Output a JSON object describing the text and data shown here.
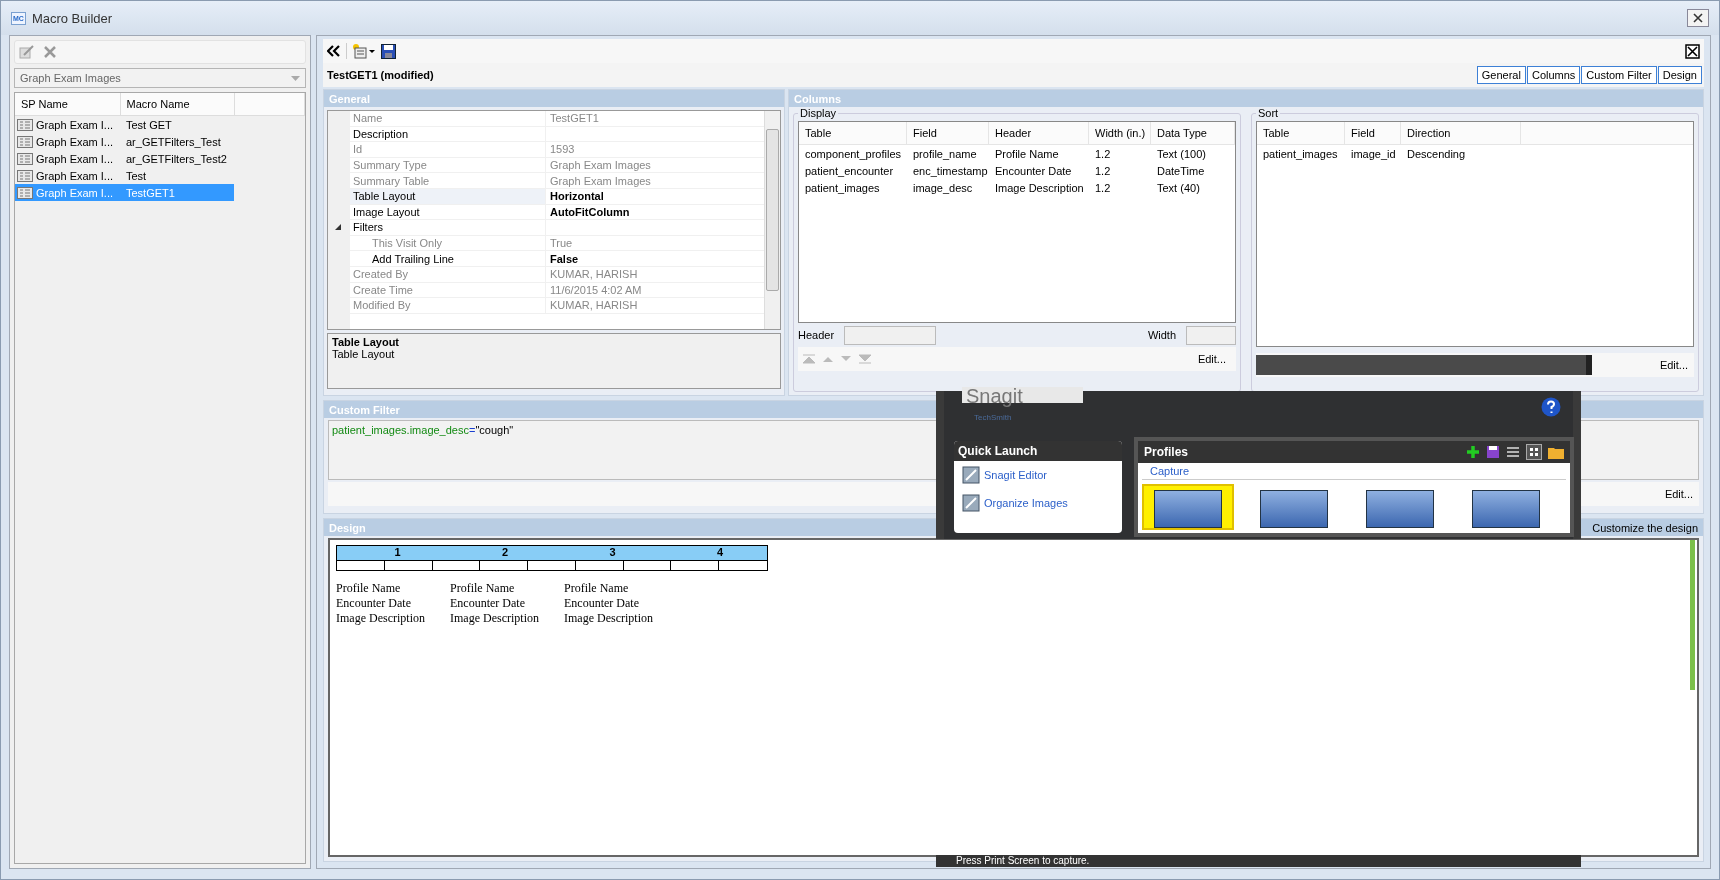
{
  "window": {
    "title": "Macro Builder",
    "icon_text": "MC"
  },
  "sidebar": {
    "dropdown": {
      "value": "Graph Exam Images"
    },
    "columns": [
      "SP Name",
      "Macro Name"
    ],
    "rows": [
      {
        "sp_name": "Graph Exam I...",
        "macro_name": "Test GET",
        "selected": false
      },
      {
        "sp_name": "Graph Exam I...",
        "macro_name": "ar_GETFilters_Test",
        "selected": false
      },
      {
        "sp_name": "Graph Exam I...",
        "macro_name": "ar_GETFilters_Test2",
        "selected": false
      },
      {
        "sp_name": "Graph Exam I...",
        "macro_name": "Test",
        "selected": false
      },
      {
        "sp_name": "Graph Exam I...",
        "macro_name": "TestGET1",
        "selected": true
      }
    ]
  },
  "editor": {
    "title": "TestGET1 (modified)",
    "tabs": [
      {
        "label": "General",
        "selected": false
      },
      {
        "label": "Columns",
        "selected": false
      },
      {
        "label": "Custom Filter",
        "selected": false
      },
      {
        "label": "Design",
        "selected": false
      }
    ]
  },
  "general": {
    "heading": "General",
    "properties": [
      {
        "name": "Name",
        "value": "TestGET1",
        "readonly": true,
        "changed": false,
        "selected": false
      },
      {
        "name": "Description",
        "readonly": false,
        "selected": false
      },
      {
        "name": "Id",
        "value": "1593",
        "readonly": true,
        "changed": false,
        "selected": false
      },
      {
        "name": "Summary Type",
        "value": "Graph Exam Images",
        "readonly": true,
        "changed": false,
        "selected": false
      },
      {
        "name": "Summary Table",
        "value": "Graph Exam Images",
        "readonly": true,
        "changed": false,
        "selected": false
      },
      {
        "name": "Table Layout",
        "value": "Horizontal",
        "readonly": false,
        "changed": true,
        "selected": true
      },
      {
        "name": "Image Layout",
        "value": "AutoFitColumn",
        "readonly": false,
        "changed": true,
        "selected": false
      },
      {
        "name": "Filters",
        "expanded": true,
        "children": [
          {
            "name": "This Visit Only",
            "value": "True",
            "readonly": true,
            "changed": false,
            "selected": false
          },
          {
            "name": "Add Trailing Line",
            "value": "False",
            "readonly": false,
            "changed": true,
            "selected": false
          }
        ]
      },
      {
        "name": "Created By",
        "value": "KUMAR, HARISH",
        "readonly": true,
        "changed": false,
        "selected": false
      },
      {
        "name": "Create Time",
        "value": "11/6/2015 4:02 AM",
        "readonly": true,
        "changed": false,
        "selected": false
      },
      {
        "name": "Modified By",
        "value": "KUMAR, HARISH",
        "readonly": true,
        "changed": false,
        "selected": false
      }
    ],
    "description": {
      "title": "Table Layout",
      "text": "Table Layout"
    }
  },
  "columns": {
    "heading": "Columns",
    "display": {
      "label": "Display",
      "columns": [
        "Table",
        "Field",
        "Header",
        "Width (in.)",
        "Data Type"
      ],
      "rows": [
        [
          "component_profiles",
          "profile_name",
          "Profile Name",
          "1.2",
          "Text (100)"
        ],
        [
          "patient_encounter",
          "enc_timestamp",
          "Encounter Date",
          "1.2",
          "DateTime"
        ],
        [
          "patient_images",
          "image_desc",
          "Image Description",
          "1.2",
          "Text (40)"
        ]
      ],
      "header_label": "Header",
      "width_label": "Width",
      "edit": "Edit..."
    },
    "sort": {
      "label": "Sort",
      "columns": [
        "Table",
        "Field",
        "Direction"
      ],
      "rows": [
        [
          "patient_images",
          "image_id",
          "Descending"
        ]
      ],
      "edit": "Edit..."
    }
  },
  "custom_filter": {
    "heading": "Custom Filter",
    "expression": [
      {
        "kind": "field",
        "text": "patient_images.image_desc"
      },
      {
        "kind": "operator",
        "text": "="
      },
      {
        "kind": "string",
        "text": "\"cough\""
      }
    ],
    "edit": "Edit..."
  },
  "design": {
    "heading": "Design",
    "hint": "Customize the design",
    "ruler": [
      "1",
      "2",
      "3",
      "4"
    ],
    "blocks": [
      [
        "Profile Name",
        "Encounter Date",
        "Image Description"
      ],
      [
        "Profile Name",
        "Encounter Date",
        "Image Description"
      ],
      [
        "Profile Name",
        "Encounter Date",
        "Image Description"
      ]
    ]
  },
  "overlay": {
    "logo": "Snagit",
    "vendor": "TechSmith",
    "quick_launch": {
      "title": "Quick Launch",
      "items": [
        "Snagit Editor",
        "Organize Images"
      ]
    },
    "profiles": {
      "title": "Profiles",
      "section": "Capture",
      "tiles": [
        {
          "selected": true
        },
        {
          "selected": false
        },
        {
          "selected": false
        },
        {
          "selected": false
        }
      ]
    },
    "status": "Press Print Screen to capture."
  }
}
